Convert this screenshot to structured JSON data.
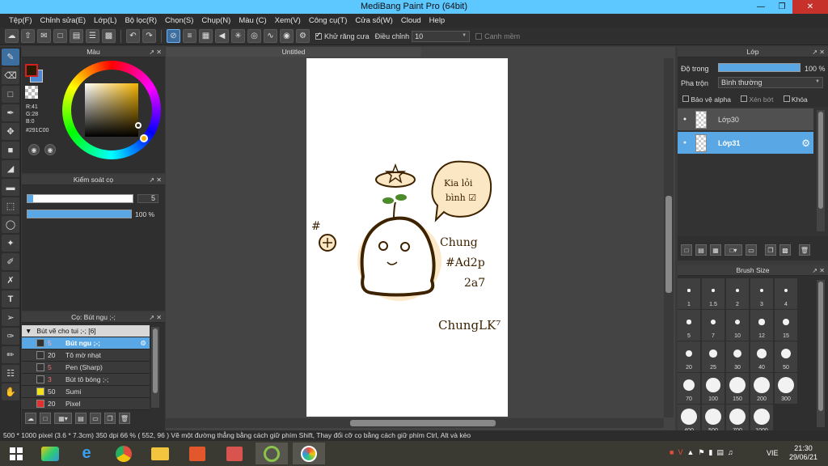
{
  "window": {
    "title": "MediBang Paint Pro (64bit)"
  },
  "menu": [
    "Tệp(F)",
    "Chỉnh sửa(E)",
    "Lớp(L)",
    "Bộ lọc(R)",
    "Chọn(S)",
    "Chụp(N)",
    "Màu (C)",
    "Xem(V)",
    "Công cụ(T)",
    "Cửa sổ(W)",
    "Cloud",
    "Help"
  ],
  "toolbar": {
    "antialias_label": "Khử răng cưa",
    "correction_label": "Điều chỉnh",
    "correction_value": "10",
    "edge_label": "Canh mềm"
  },
  "color_panel": {
    "title": "Màu",
    "r": "R:41",
    "g": "G:28",
    "b": "B:0",
    "hex": "#291C00",
    "fg_color": "#291C00",
    "bg_color": "#4d8ad1"
  },
  "brush_control": {
    "title": "Kiểm soát cọ",
    "size_value": "5",
    "opacity_value": "100 %",
    "size_fraction": 0.05,
    "opacity_fraction": 1.0
  },
  "brush_list": {
    "title": "Cọ: Bút ngu ;-;",
    "group_label": "Bút vẽ cho tui ;-; [6]",
    "items": [
      {
        "size": "5",
        "name": "Bút ngu ;-;",
        "swatch": "#333333",
        "selected": true
      },
      {
        "size": "20",
        "name": "Tô mờ nhạt",
        "swatch": "#333333",
        "selected": false
      },
      {
        "size": "5",
        "name": "Pen (Sharp)",
        "swatch": "#333333",
        "selected": false
      },
      {
        "size": "3",
        "name": "Bút tô bóng ;-;",
        "swatch": "#333333",
        "selected": false
      },
      {
        "size": "50",
        "name": "Sumi",
        "swatch": "#f2e21a",
        "selected": false
      },
      {
        "size": "20",
        "name": "Pixel",
        "swatch": "#e03030",
        "selected": false
      }
    ]
  },
  "canvas": {
    "tab_title": "Untitled"
  },
  "drawing_text": {
    "speech": "Kia lỏi\nbình ☑",
    "signature_1": "Chung\n# #Ad2p\n2a7",
    "signature_2": "ChungLK⁷"
  },
  "layer_panel": {
    "title": "Lớp",
    "opacity_label": "Độ trong",
    "opacity_value": "100 %",
    "blend_label": "Pha trộn",
    "blend_value": "Bình thường",
    "protect_alpha": "Bảo vệ alpha",
    "clipping": "Xén bớt",
    "lock": "Khóa",
    "layers": [
      {
        "name": "Lớp30",
        "selected": false
      },
      {
        "name": "Lớp31",
        "selected": true
      }
    ]
  },
  "brush_size_panel": {
    "title": "Brush Size",
    "sizes": [
      "1",
      "1.5",
      "2",
      "3",
      "4",
      "5",
      "7",
      "10",
      "12",
      "15",
      "20",
      "25",
      "30",
      "40",
      "50",
      "70",
      "100",
      "150",
      "200",
      "300",
      "400",
      "500",
      "700",
      "1000"
    ]
  },
  "status": {
    "text": "500 * 1000 pixel   (3.6 * 7.3cm)   350 dpi   66 %   ( 552, 96 )   Vẽ một đường thẳng bằng cách giữ phím Shift, Thay đổi cỡ cọ bằng cách giữ phím Ctrl, Alt và kéo"
  },
  "taskbar": {
    "lang": "VIE",
    "time": "21:30",
    "date": "29/06/21"
  }
}
